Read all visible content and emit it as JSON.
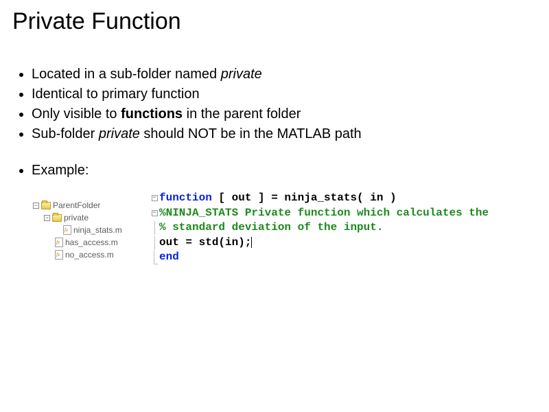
{
  "title": "Private Function",
  "bullets": {
    "b1": {
      "pre": "Located in a sub-folder named ",
      "em": "private"
    },
    "b2": "Identical to primary function",
    "b3": {
      "pre": "Only visible to ",
      "bold": "functions",
      "post": " in the parent folder"
    },
    "b4": {
      "pre": "Sub-folder ",
      "em": "private",
      "post": " should NOT be in the MATLAB path"
    }
  },
  "example_label": "Example:",
  "tree": {
    "parent": "ParentFolder",
    "private": "private",
    "ninja": "ninja_stats.m",
    "has": "has_access.m",
    "no": "no_access.m"
  },
  "code": {
    "l1": {
      "kw": "function",
      "rest": " [ out ] = ninja_stats( in )"
    },
    "l2": "%NINJA_STATS Private function which calculates the",
    "l3": "%    standard deviation of the input.",
    "l4": "out = std(in);",
    "l5": "end"
  }
}
